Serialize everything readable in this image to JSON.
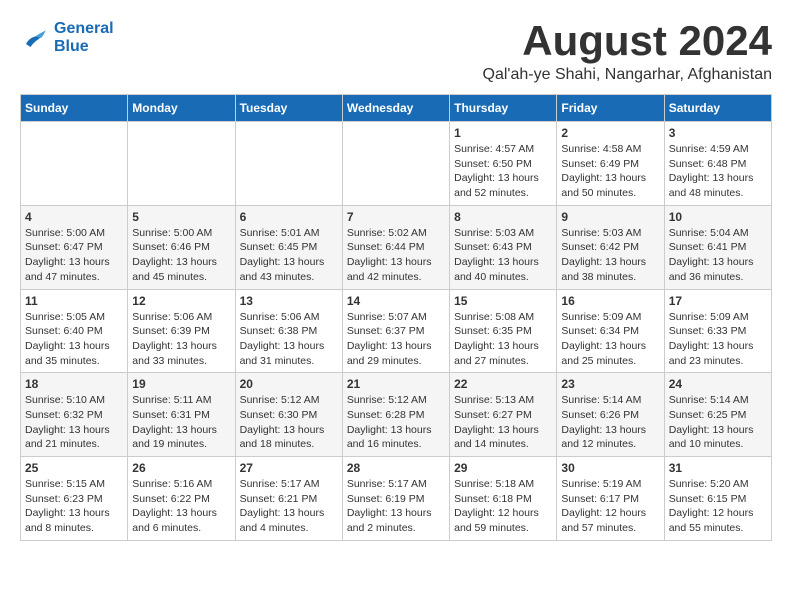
{
  "logo": {
    "line1": "General",
    "line2": "Blue"
  },
  "header": {
    "month": "August 2024",
    "location": "Qal'ah-ye Shahi, Nangarhar, Afghanistan"
  },
  "weekdays": [
    "Sunday",
    "Monday",
    "Tuesday",
    "Wednesday",
    "Thursday",
    "Friday",
    "Saturday"
  ],
  "weeks": [
    {
      "days": [
        {
          "number": "",
          "info": ""
        },
        {
          "number": "",
          "info": ""
        },
        {
          "number": "",
          "info": ""
        },
        {
          "number": "",
          "info": ""
        },
        {
          "number": "1",
          "info": "Sunrise: 4:57 AM\nSunset: 6:50 PM\nDaylight: 13 hours\nand 52 minutes."
        },
        {
          "number": "2",
          "info": "Sunrise: 4:58 AM\nSunset: 6:49 PM\nDaylight: 13 hours\nand 50 minutes."
        },
        {
          "number": "3",
          "info": "Sunrise: 4:59 AM\nSunset: 6:48 PM\nDaylight: 13 hours\nand 48 minutes."
        }
      ]
    },
    {
      "days": [
        {
          "number": "4",
          "info": "Sunrise: 5:00 AM\nSunset: 6:47 PM\nDaylight: 13 hours\nand 47 minutes."
        },
        {
          "number": "5",
          "info": "Sunrise: 5:00 AM\nSunset: 6:46 PM\nDaylight: 13 hours\nand 45 minutes."
        },
        {
          "number": "6",
          "info": "Sunrise: 5:01 AM\nSunset: 6:45 PM\nDaylight: 13 hours\nand 43 minutes."
        },
        {
          "number": "7",
          "info": "Sunrise: 5:02 AM\nSunset: 6:44 PM\nDaylight: 13 hours\nand 42 minutes."
        },
        {
          "number": "8",
          "info": "Sunrise: 5:03 AM\nSunset: 6:43 PM\nDaylight: 13 hours\nand 40 minutes."
        },
        {
          "number": "9",
          "info": "Sunrise: 5:03 AM\nSunset: 6:42 PM\nDaylight: 13 hours\nand 38 minutes."
        },
        {
          "number": "10",
          "info": "Sunrise: 5:04 AM\nSunset: 6:41 PM\nDaylight: 13 hours\nand 36 minutes."
        }
      ]
    },
    {
      "days": [
        {
          "number": "11",
          "info": "Sunrise: 5:05 AM\nSunset: 6:40 PM\nDaylight: 13 hours\nand 35 minutes."
        },
        {
          "number": "12",
          "info": "Sunrise: 5:06 AM\nSunset: 6:39 PM\nDaylight: 13 hours\nand 33 minutes."
        },
        {
          "number": "13",
          "info": "Sunrise: 5:06 AM\nSunset: 6:38 PM\nDaylight: 13 hours\nand 31 minutes."
        },
        {
          "number": "14",
          "info": "Sunrise: 5:07 AM\nSunset: 6:37 PM\nDaylight: 13 hours\nand 29 minutes."
        },
        {
          "number": "15",
          "info": "Sunrise: 5:08 AM\nSunset: 6:35 PM\nDaylight: 13 hours\nand 27 minutes."
        },
        {
          "number": "16",
          "info": "Sunrise: 5:09 AM\nSunset: 6:34 PM\nDaylight: 13 hours\nand 25 minutes."
        },
        {
          "number": "17",
          "info": "Sunrise: 5:09 AM\nSunset: 6:33 PM\nDaylight: 13 hours\nand 23 minutes."
        }
      ]
    },
    {
      "days": [
        {
          "number": "18",
          "info": "Sunrise: 5:10 AM\nSunset: 6:32 PM\nDaylight: 13 hours\nand 21 minutes."
        },
        {
          "number": "19",
          "info": "Sunrise: 5:11 AM\nSunset: 6:31 PM\nDaylight: 13 hours\nand 19 minutes."
        },
        {
          "number": "20",
          "info": "Sunrise: 5:12 AM\nSunset: 6:30 PM\nDaylight: 13 hours\nand 18 minutes."
        },
        {
          "number": "21",
          "info": "Sunrise: 5:12 AM\nSunset: 6:28 PM\nDaylight: 13 hours\nand 16 minutes."
        },
        {
          "number": "22",
          "info": "Sunrise: 5:13 AM\nSunset: 6:27 PM\nDaylight: 13 hours\nand 14 minutes."
        },
        {
          "number": "23",
          "info": "Sunrise: 5:14 AM\nSunset: 6:26 PM\nDaylight: 13 hours\nand 12 minutes."
        },
        {
          "number": "24",
          "info": "Sunrise: 5:14 AM\nSunset: 6:25 PM\nDaylight: 13 hours\nand 10 minutes."
        }
      ]
    },
    {
      "days": [
        {
          "number": "25",
          "info": "Sunrise: 5:15 AM\nSunset: 6:23 PM\nDaylight: 13 hours\nand 8 minutes."
        },
        {
          "number": "26",
          "info": "Sunrise: 5:16 AM\nSunset: 6:22 PM\nDaylight: 13 hours\nand 6 minutes."
        },
        {
          "number": "27",
          "info": "Sunrise: 5:17 AM\nSunset: 6:21 PM\nDaylight: 13 hours\nand 4 minutes."
        },
        {
          "number": "28",
          "info": "Sunrise: 5:17 AM\nSunset: 6:19 PM\nDaylight: 13 hours\nand 2 minutes."
        },
        {
          "number": "29",
          "info": "Sunrise: 5:18 AM\nSunset: 6:18 PM\nDaylight: 12 hours\nand 59 minutes."
        },
        {
          "number": "30",
          "info": "Sunrise: 5:19 AM\nSunset: 6:17 PM\nDaylight: 12 hours\nand 57 minutes."
        },
        {
          "number": "31",
          "info": "Sunrise: 5:20 AM\nSunset: 6:15 PM\nDaylight: 12 hours\nand 55 minutes."
        }
      ]
    }
  ]
}
